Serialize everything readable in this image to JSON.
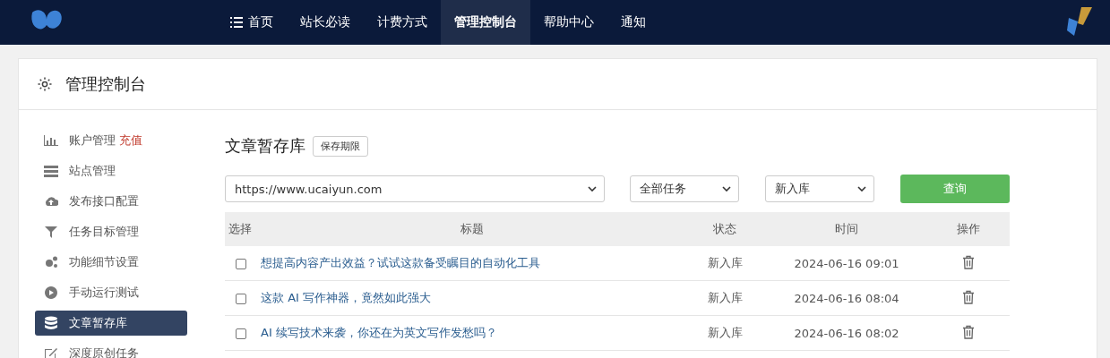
{
  "nav": {
    "items": [
      {
        "label": "首页",
        "selected": false
      },
      {
        "label": "站长必读",
        "selected": false
      },
      {
        "label": "计费方式",
        "selected": false
      },
      {
        "label": "管理控制台",
        "selected": true
      },
      {
        "label": "帮助中心",
        "selected": false
      },
      {
        "label": "通知",
        "selected": false
      }
    ]
  },
  "panel": {
    "title": "管理控制台"
  },
  "sidebar": {
    "items": [
      {
        "label": "账户管理",
        "badge": "充值",
        "selected": false
      },
      {
        "label": "站点管理",
        "selected": false
      },
      {
        "label": "发布接口配置",
        "selected": false
      },
      {
        "label": "任务目标管理",
        "selected": false
      },
      {
        "label": "功能细节设置",
        "selected": false
      },
      {
        "label": "手动运行测试",
        "selected": false
      },
      {
        "label": "文章暂存库",
        "selected": true
      },
      {
        "label": "深度原创任务",
        "selected": false
      }
    ]
  },
  "content": {
    "title": "文章暂存库",
    "title_button": "保存期限",
    "filters": [
      {
        "value": "https://www.ucaiyun.com"
      },
      {
        "value": "全部任务"
      },
      {
        "value": "新入库"
      }
    ],
    "query_button": "查询",
    "table": {
      "columns": [
        "选择",
        "标题",
        "状态",
        "时间",
        "操作"
      ],
      "rows": [
        {
          "checked": false,
          "title": "想提高内容产出效益？试试这款备受瞩目的自动化工具",
          "status": "新入库",
          "time": "2024-06-16 09:01"
        },
        {
          "checked": false,
          "title": "这款 AI 写作神器，竟然如此强大",
          "status": "新入库",
          "time": "2024-06-16 08:04"
        },
        {
          "checked": false,
          "title": "AI 续写技术来袭，你还在为英文写作发愁吗？",
          "status": "新入库",
          "time": "2024-06-16 08:02"
        }
      ]
    }
  }
}
